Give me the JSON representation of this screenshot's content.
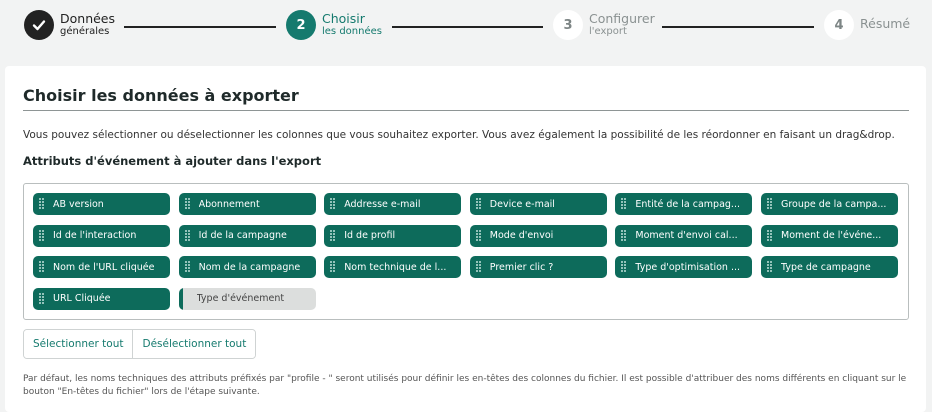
{
  "stepper": {
    "steps": [
      {
        "number": "",
        "label": "Données",
        "sublabel": "générales",
        "state": "done",
        "icon": "check-icon"
      },
      {
        "number": "2",
        "label": "Choisir",
        "sublabel": "les données",
        "state": "active"
      },
      {
        "number": "3",
        "label": "Configurer",
        "sublabel": "l'export",
        "state": "idle"
      },
      {
        "number": "4",
        "label": "Résumé",
        "sublabel": "",
        "state": "idle"
      }
    ]
  },
  "main": {
    "title": "Choisir les données à exporter",
    "description": "Vous pouvez sélectionner ou déselectionner les colonnes que vous souhaitez exporter. Vous avez également la possibilité de les réordonner en faisant un drag&drop.",
    "subtitle": "Attributs d'événement à ajouter dans l'export",
    "attributes": [
      {
        "label": "AB version",
        "selected": true
      },
      {
        "label": "Abonnement",
        "selected": true
      },
      {
        "label": "Addresse e-mail",
        "selected": true
      },
      {
        "label": "Device e-mail",
        "selected": true
      },
      {
        "label": "Entité de la campag...",
        "selected": true
      },
      {
        "label": "Groupe de la campa...",
        "selected": true
      },
      {
        "label": "Id de l'interaction",
        "selected": true
      },
      {
        "label": "Id de la campagne",
        "selected": true
      },
      {
        "label": "Id de profil",
        "selected": true
      },
      {
        "label": "Mode d'envoi",
        "selected": true
      },
      {
        "label": "Moment d'envoi cal...",
        "selected": true
      },
      {
        "label": "Moment de l'événe...",
        "selected": true
      },
      {
        "label": "Nom de l'URL cliquée",
        "selected": true
      },
      {
        "label": "Nom de la campagne",
        "selected": true
      },
      {
        "label": "Nom technique de l...",
        "selected": true
      },
      {
        "label": "Premier clic ?",
        "selected": true
      },
      {
        "label": "Type d'optimisation ...",
        "selected": true
      },
      {
        "label": "Type de campagne",
        "selected": true
      },
      {
        "label": "URL Cliquée",
        "selected": true
      },
      {
        "label": "Type d'événement",
        "selected": false
      }
    ],
    "select_all_label": "Sélectionner tout",
    "deselect_all_label": "Désélectionner tout",
    "note": "Par défaut, les noms techniques des attributs préfixés par \"profile - \" seront utilisés pour définir les en-têtes des colonnes du fichier. Il est possible d'attribuer des noms différents en cliquant sur le bouton \"En-têtes du fichier\" lors de l'étape suivante."
  },
  "colors": {
    "accent": "#157a6e",
    "chip_selected": "#0d6b5b",
    "chip_unselected": "#dcdedd"
  }
}
